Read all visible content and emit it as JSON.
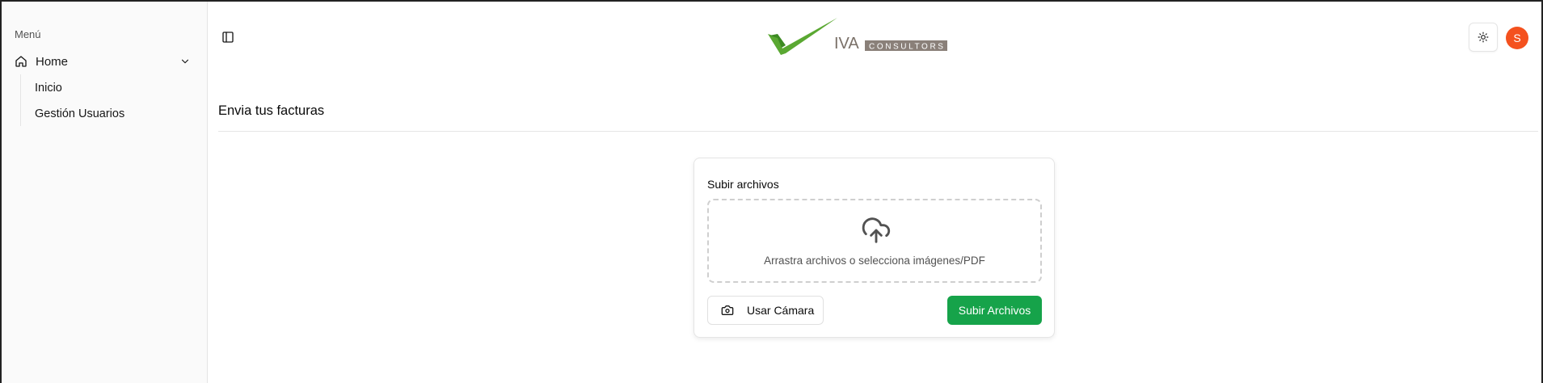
{
  "sidebar": {
    "group_label": "Menú",
    "home": {
      "label": "Home",
      "icon": "home-icon"
    },
    "sub_items": [
      {
        "label": "Inicio"
      },
      {
        "label": "Gestión Usuarios"
      }
    ]
  },
  "header": {
    "logo_text": "IVA CONSULTORS",
    "avatar_initial": "S",
    "avatar_color": "#f4511e"
  },
  "page": {
    "title": "Envia tus facturas"
  },
  "upload_card": {
    "title": "Subir archivos",
    "dropzone_text": "Arrastra archivos o selecciona imágenes/PDF",
    "camera_button": "Usar Cámara",
    "submit_button": "Subir Archivos",
    "accent_color": "#16a34a"
  }
}
